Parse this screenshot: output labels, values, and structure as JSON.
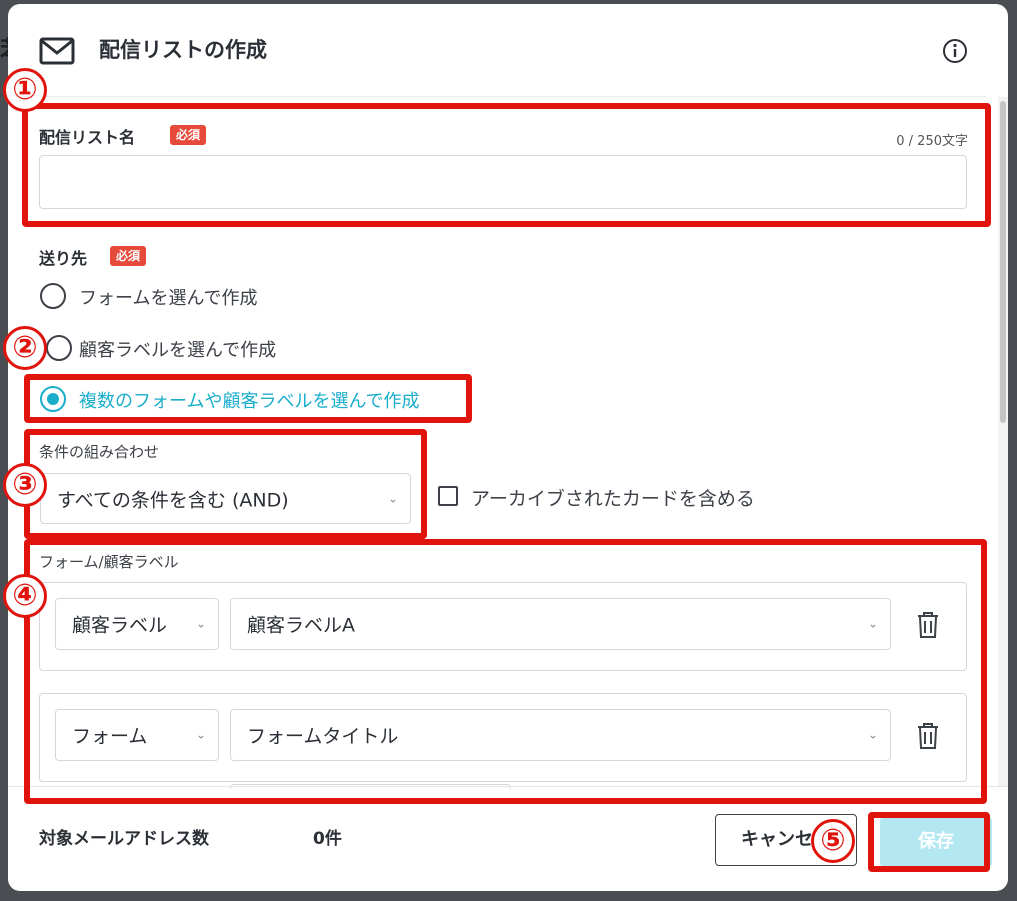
{
  "background": {
    "glyph": "苯"
  },
  "header": {
    "title": "配信リストの作成",
    "mail_icon": "mail-icon",
    "info_icon": "info-icon"
  },
  "list_name": {
    "label": "配信リスト名",
    "required": "必須",
    "counter": "0 / 250文字",
    "value": ""
  },
  "destination": {
    "label": "送り先",
    "required": "必須",
    "options": [
      {
        "label": "フォームを選んで作成",
        "selected": false
      },
      {
        "label": "顧客ラベルを選んで作成",
        "selected": false
      },
      {
        "label": "複数のフォームや顧客ラベルを選んで作成",
        "selected": true
      }
    ]
  },
  "condition": {
    "label": "条件の組み合わせ",
    "value": "すべての条件を含む (AND)"
  },
  "archive": {
    "label": "アーカイブされたカードを含める",
    "checked": false
  },
  "items": {
    "label": "フォーム/顧客ラベル",
    "rows": [
      {
        "type": "顧客ラベル",
        "value": "顧客ラベルA"
      },
      {
        "type": "フォーム",
        "value": "フォームタイトル"
      }
    ]
  },
  "footer": {
    "target_label": "対象メールアドレス数",
    "target_value": "0件",
    "cancel": "キャンセル",
    "save": "保存"
  },
  "annotations": [
    "①",
    "②",
    "③",
    "④",
    "⑤"
  ],
  "colors": {
    "accent": "#1aaecb",
    "required": "#e64a3b",
    "annotation": "#e0140d",
    "save_disabled": "#b3e8f3"
  }
}
